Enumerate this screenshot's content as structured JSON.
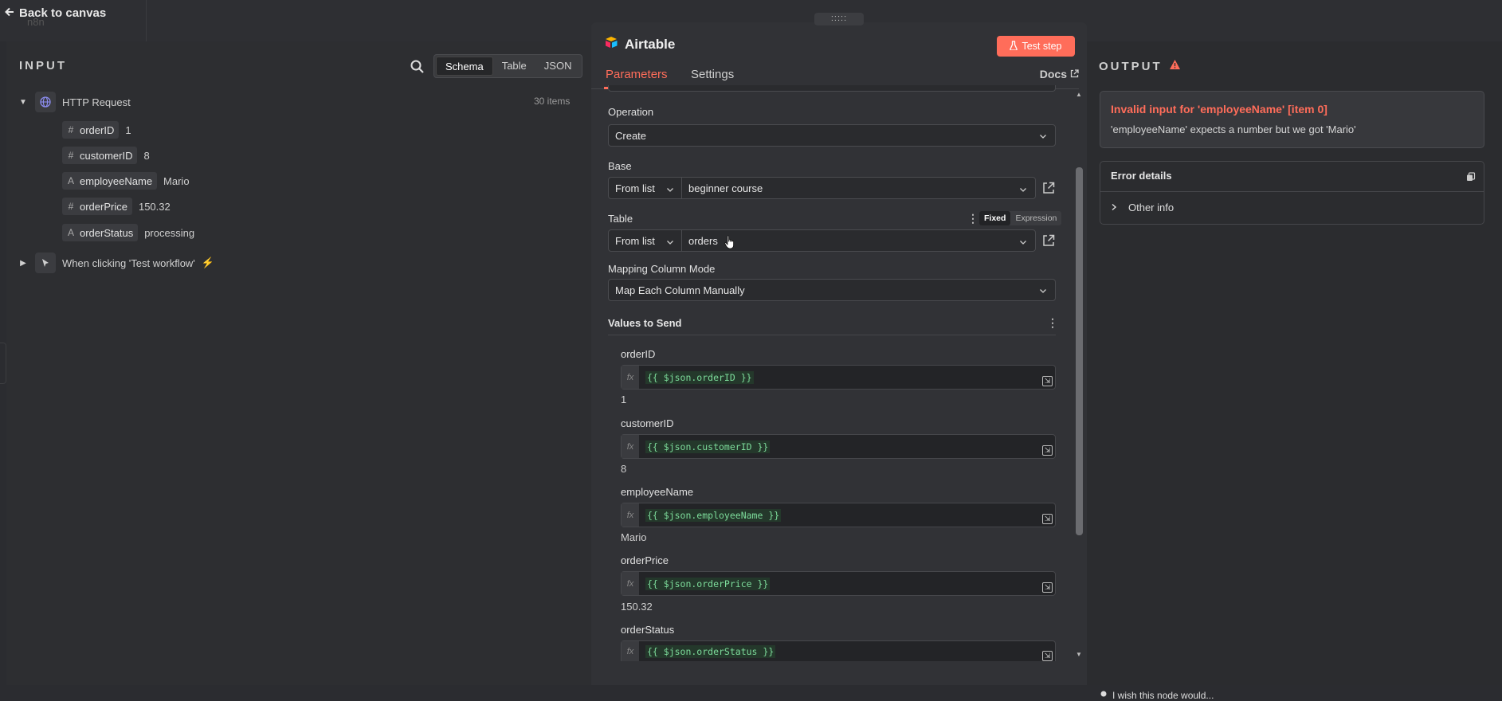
{
  "topbar": {
    "back_label": "Back to canvas",
    "ghost_logo": "n8n"
  },
  "input": {
    "title": "INPUT",
    "view_modes": [
      "Schema",
      "Table",
      "JSON"
    ],
    "active_view": "Schema",
    "node": {
      "name": "HTTP Request",
      "items_count": "30 items"
    },
    "fields": [
      {
        "type": "#",
        "name": "orderID",
        "value": "1"
      },
      {
        "type": "#",
        "name": "customerID",
        "value": "8"
      },
      {
        "type": "A",
        "name": "employeeName",
        "value": "Mario"
      },
      {
        "type": "#",
        "name": "orderPrice",
        "value": "150.32"
      },
      {
        "type": "A",
        "name": "orderStatus",
        "value": "processing"
      }
    ],
    "trigger_node": "When clicking 'Test workflow'"
  },
  "node_panel": {
    "title": "Airtable",
    "test_step_label": "Test step",
    "tabs": [
      "Parameters",
      "Settings"
    ],
    "active_tab": "Parameters",
    "docs_label": "Docs",
    "operation": {
      "label": "Operation",
      "value": "Create"
    },
    "base": {
      "label": "Base",
      "mode": "From list",
      "value": "beginner course"
    },
    "table": {
      "label": "Table",
      "mode": "From list",
      "value": "orders",
      "toggle": [
        "Fixed",
        "Expression"
      ],
      "toggle_active": "Fixed"
    },
    "mapping": {
      "label": "Mapping Column Mode",
      "value": "Map Each Column Manually"
    },
    "values_title": "Values to Send",
    "values": [
      {
        "name": "orderID",
        "expr": "{{ $json.orderID }}",
        "result": "1"
      },
      {
        "name": "customerID",
        "expr": "{{ $json.customerID }}",
        "result": "8"
      },
      {
        "name": "employeeName",
        "expr": "{{ $json.employeeName }}",
        "result": "Mario"
      },
      {
        "name": "orderPrice",
        "expr": "{{ $json.orderPrice }}",
        "result": "150.32"
      },
      {
        "name": "orderStatus",
        "expr": "{{ $json.orderStatus }}",
        "result": ""
      }
    ]
  },
  "output": {
    "title": "OUTPUT",
    "error_title": "Invalid input for 'employeeName' [item 0]",
    "error_message": "'employeeName' expects a number but we got 'Mario'",
    "details_label": "Error details",
    "other_info_label": "Other info",
    "wish_label": "I wish this node would..."
  },
  "colors": {
    "accent": "#ff6d5a",
    "code": "#7ddc9b",
    "panel": "#313236"
  }
}
